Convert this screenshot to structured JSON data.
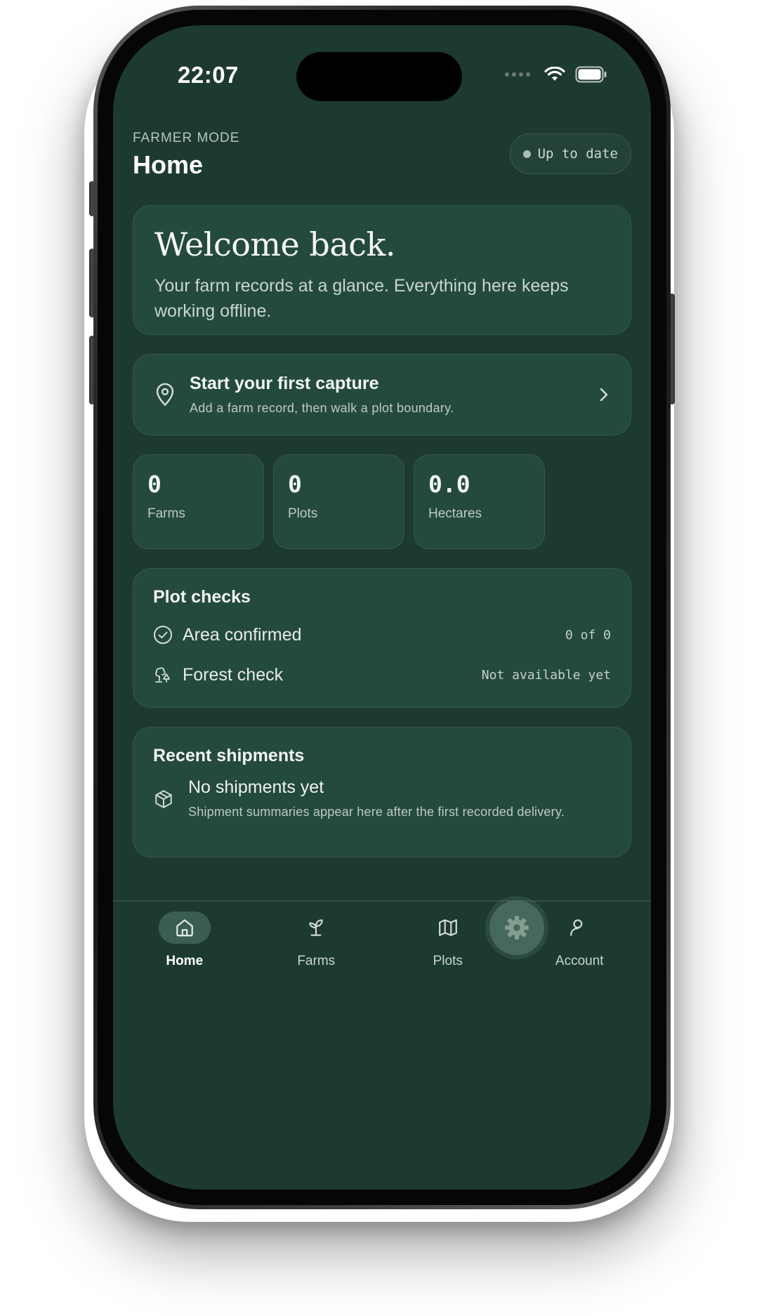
{
  "status_bar": {
    "time": "22:07"
  },
  "header": {
    "mode": "FARMER MODE",
    "title": "Home",
    "sync_status": "Up to date"
  },
  "welcome": {
    "title": "Welcome back.",
    "subtitle": "Your farm records at a glance. Everything here keeps working offline."
  },
  "capture": {
    "title": "Start your first capture",
    "subtitle": "Add a farm record, then walk a plot boundary.",
    "icon": "map-pin-icon"
  },
  "stats": [
    {
      "value": "0",
      "label": "Farms"
    },
    {
      "value": "0",
      "label": "Plots"
    },
    {
      "value": "0.0",
      "label": "Hectares"
    }
  ],
  "plot_checks": {
    "title": "Plot checks",
    "rows": [
      {
        "label": "Area confirmed",
        "value": "0 of 0",
        "icon": "check-circle-icon"
      },
      {
        "label": "Forest check",
        "value": "Not available yet",
        "icon": "trees-icon"
      }
    ]
  },
  "shipments": {
    "title": "Recent shipments",
    "empty_title": "No shipments yet",
    "empty_subtitle": "Shipment summaries appear here after the first recorded delivery.",
    "icon": "package-icon"
  },
  "nav": {
    "items": [
      {
        "label": "Home",
        "icon": "home-icon",
        "active": true
      },
      {
        "label": "Farms",
        "icon": "sprout-icon",
        "active": false
      },
      {
        "label": "Plots",
        "icon": "map-icon",
        "active": false
      },
      {
        "label": "Account",
        "icon": "user-icon",
        "active": false
      }
    ]
  },
  "colors": {
    "background": "#1d3a30",
    "card": "#244a3d",
    "card_border": "#35594b",
    "active_nav": "#3a5f52"
  }
}
